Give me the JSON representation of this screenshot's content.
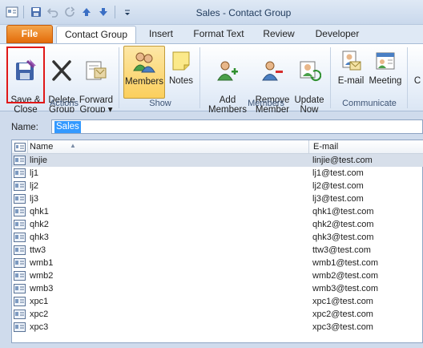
{
  "window": {
    "title": "Sales  -  Contact Group"
  },
  "tabs": [
    {
      "label": "File"
    },
    {
      "label": "Contact Group"
    },
    {
      "label": "Insert"
    },
    {
      "label": "Format Text"
    },
    {
      "label": "Review"
    },
    {
      "label": "Developer"
    }
  ],
  "ribbon": {
    "actions": {
      "save_close": "Save &\nClose",
      "delete_group": "Delete\nGroup",
      "forward_group": "Forward\nGroup ▾",
      "label": "Actions"
    },
    "show": {
      "members": "Members",
      "notes": "Notes",
      "label": "Show"
    },
    "members": {
      "add_members": "Add\nMembers ▾",
      "remove_member": "Remove\nMember",
      "update_now": "Update\nNow",
      "label": "Members"
    },
    "communicate": {
      "email": "E-mail",
      "meeting": "Meeting",
      "label": "Communicate"
    },
    "overflow_label": "C"
  },
  "name_field": {
    "label": "Name:",
    "value": "Sales"
  },
  "list": {
    "columns": {
      "name": "Name",
      "email": "E-mail"
    },
    "rows": [
      {
        "name": "linjie",
        "email": "linjie@test.com"
      },
      {
        "name": "lj1",
        "email": "lj1@test.com"
      },
      {
        "name": "lj2",
        "email": "lj2@test.com"
      },
      {
        "name": "lj3",
        "email": "lj3@test.com"
      },
      {
        "name": "qhk1",
        "email": "qhk1@test.com"
      },
      {
        "name": "qhk2",
        "email": "qhk2@test.com"
      },
      {
        "name": "qhk3",
        "email": "qhk3@test.com"
      },
      {
        "name": "ttw3",
        "email": "ttw3@test.com"
      },
      {
        "name": "wmb1",
        "email": "wmb1@test.com"
      },
      {
        "name": "wmb2",
        "email": "wmb2@test.com"
      },
      {
        "name": "wmb3",
        "email": "wmb3@test.com"
      },
      {
        "name": "xpc1",
        "email": "xpc1@test.com"
      },
      {
        "name": "xpc2",
        "email": "xpc2@test.com"
      },
      {
        "name": "xpc3",
        "email": "xpc3@test.com"
      }
    ]
  },
  "colors": {
    "file_tab": "#e46c0a",
    "pressed": "#fbcf5d",
    "highlight_box": "#e01818",
    "selection": "#3399ff"
  }
}
